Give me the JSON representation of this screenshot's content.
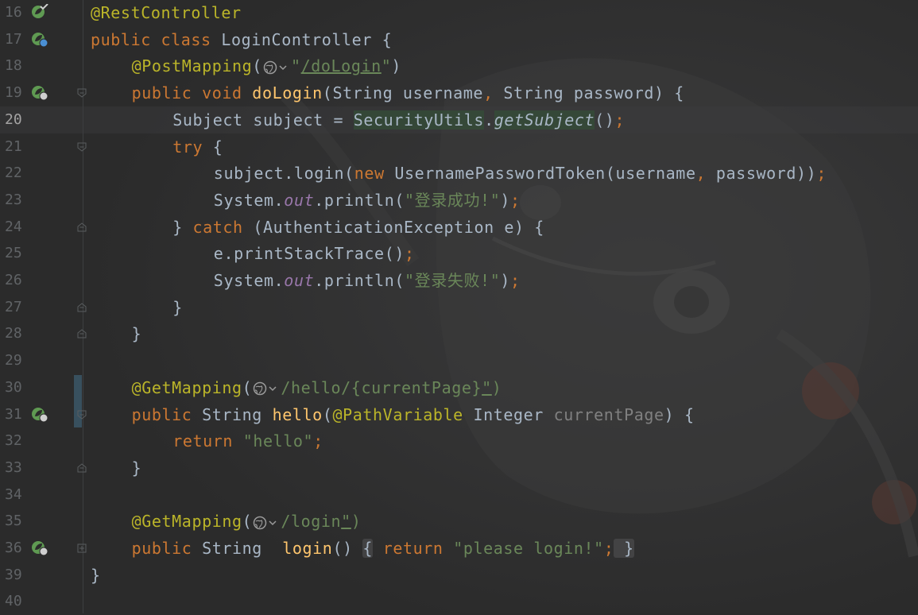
{
  "editor": {
    "current_line": "20",
    "lines": [
      {
        "n": "16",
        "icon": "spring-bean-icon",
        "fold": "",
        "t": [
          "@RestController"
        ]
      },
      {
        "n": "17",
        "icon": "spring-controller-icon",
        "fold": "",
        "t": [
          "public class ",
          "LoginController",
          " {"
        ]
      },
      {
        "n": "18",
        "icon": "",
        "fold": "",
        "t": [
          "@PostMapping",
          "(",
          ")",
          "\"",
          "/doLogin",
          "\"",
          ")"
        ]
      },
      {
        "n": "19",
        "icon": "spring-mapping-icon",
        "fold": "open",
        "t": [
          "public void ",
          "doLogin",
          "(String username",
          ", ",
          "String password) {"
        ]
      },
      {
        "n": "20",
        "icon": "",
        "fold": "",
        "t": [
          "Subject subject = ",
          "SecurityUtils",
          ".",
          "getSubject",
          "()",
          ";"
        ]
      },
      {
        "n": "21",
        "icon": "",
        "fold": "open",
        "t": [
          "try",
          " {"
        ]
      },
      {
        "n": "22",
        "icon": "",
        "fold": "",
        "t": [
          "subject.login(",
          "new ",
          "UsernamePasswordToken(username",
          ", ",
          "password))",
          ";"
        ]
      },
      {
        "n": "23",
        "icon": "",
        "fold": "",
        "t": [
          "System.",
          "out",
          ".println(",
          "\"登录成功!\"",
          ")",
          ";"
        ]
      },
      {
        "n": "24",
        "icon": "",
        "fold": "close",
        "t": [
          "} ",
          "catch",
          " (AuthenticationException e) {"
        ]
      },
      {
        "n": "25",
        "icon": "",
        "fold": "",
        "t": [
          "e.printStackTrace()",
          ";"
        ]
      },
      {
        "n": "26",
        "icon": "",
        "fold": "",
        "t": [
          "System.",
          "out",
          ".println(",
          "\"登录失败!\"",
          ")",
          ";"
        ]
      },
      {
        "n": "27",
        "icon": "",
        "fold": "close",
        "t": [
          "}"
        ]
      },
      {
        "n": "28",
        "icon": "",
        "fold": "close",
        "t": [
          "}"
        ]
      },
      {
        "n": "29",
        "icon": "",
        "fold": "",
        "t": []
      },
      {
        "n": "30",
        "icon": "",
        "fold": "",
        "t": [
          "@GetMapping",
          "(",
          "\"",
          "/hello/{currentPage}",
          "\"",
          ")"
        ]
      },
      {
        "n": "31",
        "icon": "spring-mapping-icon",
        "fold": "open",
        "t": [
          "public ",
          "String ",
          "hello",
          "(",
          "@PathVariable",
          " Integer ",
          "currentPage",
          ") {"
        ]
      },
      {
        "n": "32",
        "icon": "",
        "fold": "",
        "t": [
          "return ",
          "\"hello\"",
          ";"
        ]
      },
      {
        "n": "33",
        "icon": "",
        "fold": "close",
        "t": [
          "}"
        ]
      },
      {
        "n": "34",
        "icon": "",
        "fold": "",
        "t": []
      },
      {
        "n": "35",
        "icon": "",
        "fold": "",
        "t": [
          "@GetMapping",
          "(",
          "\"",
          "/login",
          "\"",
          ")"
        ]
      },
      {
        "n": "36",
        "icon": "spring-mapping-icon",
        "fold": "plus",
        "t": [
          "public ",
          "String  ",
          "login",
          "() ",
          "{",
          " return ",
          "\"please login!\"",
          ";",
          " }"
        ]
      },
      {
        "n": "39",
        "icon": "",
        "fold": "",
        "t": [
          "}"
        ]
      },
      {
        "n": "40",
        "icon": "",
        "fold": "",
        "t": []
      }
    ]
  },
  "colors": {
    "background": "#2b2b2b",
    "keyword": "#cc7832",
    "annotation": "#bbb529",
    "method": "#ffc66d",
    "string": "#6a8759",
    "field": "#9876aa",
    "text": "#a9b7c6",
    "line_number": "#606366"
  }
}
